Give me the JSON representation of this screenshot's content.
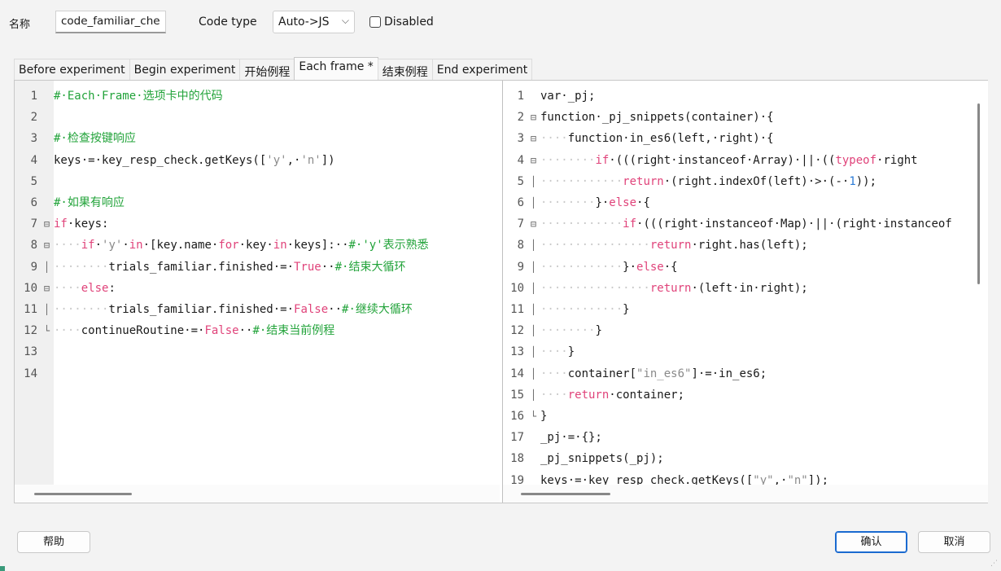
{
  "header": {
    "name_label": "名称",
    "name_value": "code_familiar_che",
    "codetype_label": "Code type",
    "codetype_value": "Auto->JS",
    "disabled_label": "Disabled"
  },
  "tabs": [
    {
      "label": "Before experiment",
      "active": false
    },
    {
      "label": "Begin experiment",
      "active": false
    },
    {
      "label": "开始例程",
      "active": false
    },
    {
      "label": "Each frame *",
      "active": true
    },
    {
      "label": "结束例程",
      "active": false
    },
    {
      "label": "End experiment",
      "active": false
    }
  ],
  "left_editor": {
    "lines": [
      {
        "n": "1",
        "fold": "",
        "html": "<span class='c-comment'>#·Each·Frame·选项卡中的代码</span>"
      },
      {
        "n": "2",
        "fold": "",
        "html": ""
      },
      {
        "n": "3",
        "fold": "",
        "html": "<span class='c-comment'>#·检查按键响应</span>"
      },
      {
        "n": "4",
        "fold": "",
        "html": "keys·=·key_resp_check.getKeys([<span class='c-str'>'y'</span>,·<span class='c-str'>'n'</span>])"
      },
      {
        "n": "5",
        "fold": "",
        "html": ""
      },
      {
        "n": "6",
        "fold": "",
        "html": "<span class='c-comment'>#·如果有响应</span>"
      },
      {
        "n": "7",
        "fold": "⊟",
        "html": "<span class='c-kw'>if</span>·keys:"
      },
      {
        "n": "8",
        "fold": "⊟",
        "html": "<span class='ws'>····</span><span class='c-kw'>if</span>·<span class='c-str'>'y'</span>·<span class='c-kw'>in</span>·[key.name·<span class='c-kw'>for</span>·key·<span class='c-kw'>in</span>·keys]:··<span class='c-comment'>#·'y'表示熟悉</span>"
      },
      {
        "n": "9",
        "fold": "│",
        "html": "<span class='ws'>········</span>trials_familiar.finished·=·<span class='c-kw'>True</span>··<span class='c-comment'>#·结束大循环</span>"
      },
      {
        "n": "10",
        "fold": "⊟",
        "html": "<span class='ws'>····</span><span class='c-kw'>else</span>:"
      },
      {
        "n": "11",
        "fold": "│",
        "html": "<span class='ws'>········</span>trials_familiar.finished·=·<span class='c-kw'>False</span>··<span class='c-comment'>#·继续大循环</span>"
      },
      {
        "n": "12",
        "fold": "└",
        "html": "<span class='ws'>····</span>continueRoutine·=·<span class='c-kw'>False</span>··<span class='c-comment'>#·结束当前例程</span>"
      },
      {
        "n": "13",
        "fold": "",
        "html": ""
      },
      {
        "n": "14",
        "fold": "",
        "html": ""
      }
    ]
  },
  "right_editor": {
    "lines": [
      {
        "n": "1",
        "fold": "",
        "html": "var·_pj;"
      },
      {
        "n": "2",
        "fold": "⊟",
        "html": "function·_pj_snippets(container)·{"
      },
      {
        "n": "3",
        "fold": "⊟",
        "html": "<span class='ws'>····</span>function·in_es6(left,·right)·{"
      },
      {
        "n": "4",
        "fold": "⊟",
        "html": "<span class='ws'>········</span><span class='c-kw'>if</span>·(((right·instanceof·Array)·||·((<span class='c-kw'>typeof</span>·right"
      },
      {
        "n": "5",
        "fold": "│",
        "html": "<span class='ws'>············</span><span class='c-kw'>return</span>·(right.indexOf(left)·&gt;·(-·<span class='c-num'>1</span>));"
      },
      {
        "n": "6",
        "fold": "│",
        "html": "<span class='ws'>········</span>}·<span class='c-kw'>else</span>·{"
      },
      {
        "n": "7",
        "fold": "⊟",
        "html": "<span class='ws'>············</span><span class='c-kw'>if</span>·(((right·instanceof·Map)·||·(right·instanceof"
      },
      {
        "n": "8",
        "fold": "│",
        "html": "<span class='ws'>················</span><span class='c-kw'>return</span>·right.has(left);"
      },
      {
        "n": "9",
        "fold": "│",
        "html": "<span class='ws'>············</span>}·<span class='c-kw'>else</span>·{"
      },
      {
        "n": "10",
        "fold": "│",
        "html": "<span class='ws'>················</span><span class='c-kw'>return</span>·(left·in·right);"
      },
      {
        "n": "11",
        "fold": "│",
        "html": "<span class='ws'>············</span>}"
      },
      {
        "n": "12",
        "fold": "│",
        "html": "<span class='ws'>········</span>}"
      },
      {
        "n": "13",
        "fold": "│",
        "html": "<span class='ws'>····</span>}"
      },
      {
        "n": "14",
        "fold": "│",
        "html": "<span class='ws'>····</span>container[<span class='c-str'>\"in_es6\"</span>]·=·in_es6;"
      },
      {
        "n": "15",
        "fold": "│",
        "html": "<span class='ws'>····</span><span class='c-kw'>return</span>·container;"
      },
      {
        "n": "16",
        "fold": "└",
        "html": "}"
      },
      {
        "n": "17",
        "fold": "",
        "html": "_pj·=·{};"
      },
      {
        "n": "18",
        "fold": "",
        "html": "_pj_snippets(_pj);"
      },
      {
        "n": "19",
        "fold": "",
        "html": "keys·=·key_resp_check.getKeys([<span class='c-str'>\"y\"</span>,·<span class='c-str'>\"n\"</span>]);"
      }
    ]
  },
  "buttons": {
    "help": "帮助",
    "ok": "确认",
    "cancel": "取消"
  }
}
